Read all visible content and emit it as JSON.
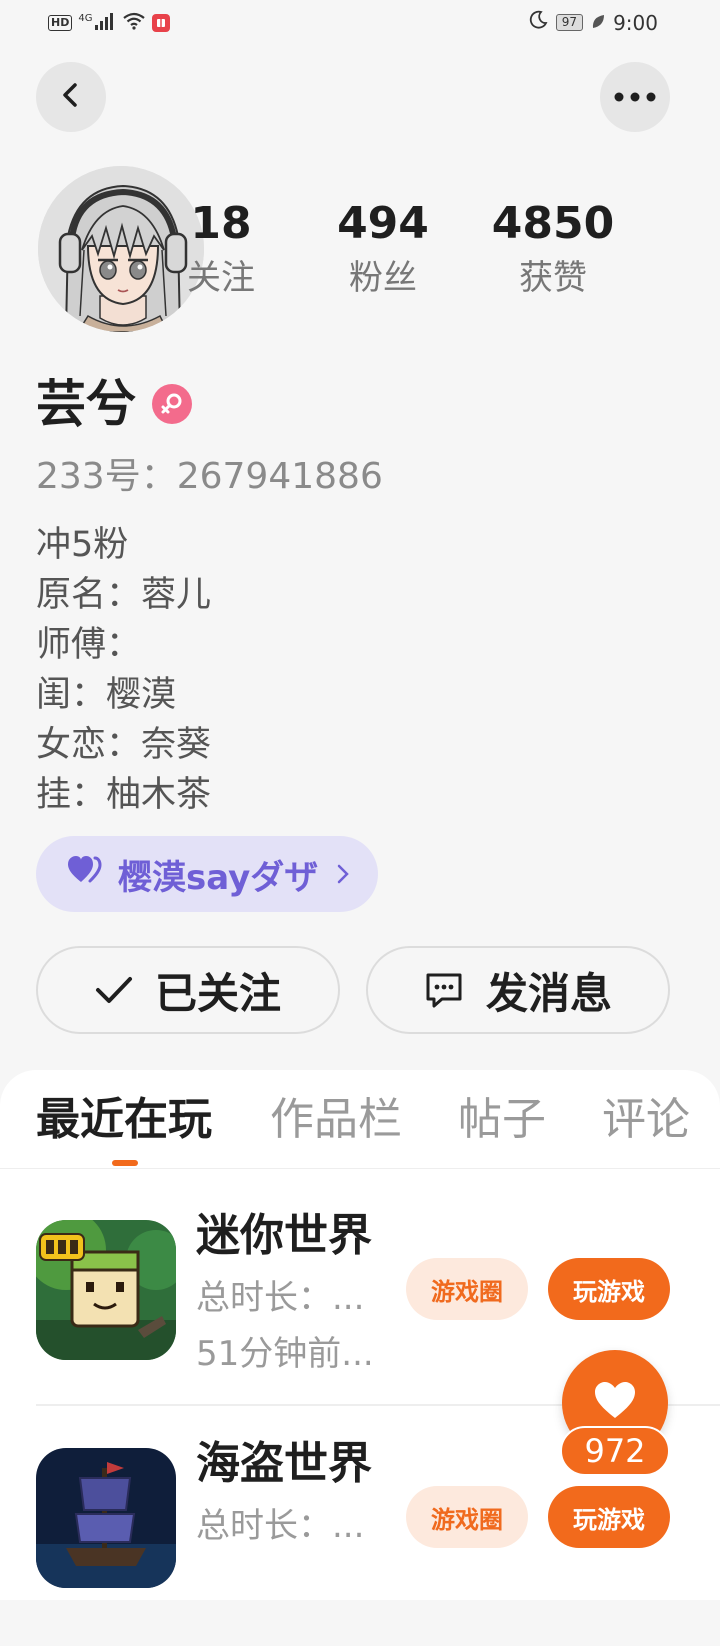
{
  "status_bar": {
    "hd": "HD",
    "network": "4G",
    "battery": "97",
    "time": "9:00"
  },
  "header": {
    "back_icon": "chevron-left-icon",
    "more_icon": "more-dots-icon"
  },
  "profile": {
    "avatar": "anime-girl-avatar",
    "stats": [
      {
        "value": "18",
        "label": "关注"
      },
      {
        "value": "494",
        "label": "粉丝"
      },
      {
        "value": "4850",
        "label": "获赞"
      }
    ],
    "name": "芸兮",
    "gender_icon": "female-icon",
    "id_text": "233号：267941886",
    "bio_lines": [
      "冲5粉",
      "原名：蓉儿",
      "师傅：",
      "闺：樱漠",
      "女恋：奈葵",
      "挂：柚木茶"
    ],
    "relation_tag": {
      "icon": "heart-pair-icon",
      "label": "樱漠sayダザ",
      "color": "#6f5fd6",
      "background": "#e3e1f7"
    }
  },
  "actions": {
    "follow_label": "已关注",
    "message_label": "发消息"
  },
  "tabs": [
    "最近在玩",
    "作品栏",
    "帖子",
    "评论"
  ],
  "active_tab": "最近在玩",
  "games": [
    {
      "title": "迷你世界",
      "duration": "总时长：...",
      "last_played": "51分钟前...",
      "circle_label": "游戏圈",
      "play_label": "玩游戏"
    },
    {
      "title": "海盗世界",
      "duration": "总时长：...",
      "circle_label": "游戏圈",
      "play_label": "玩游戏"
    }
  ],
  "floating_like": {
    "icon": "heart-icon",
    "count": "972"
  },
  "colors": {
    "accent": "#f26a1c",
    "accent_light": "#fde9dd",
    "background": "#f6f6f6"
  }
}
